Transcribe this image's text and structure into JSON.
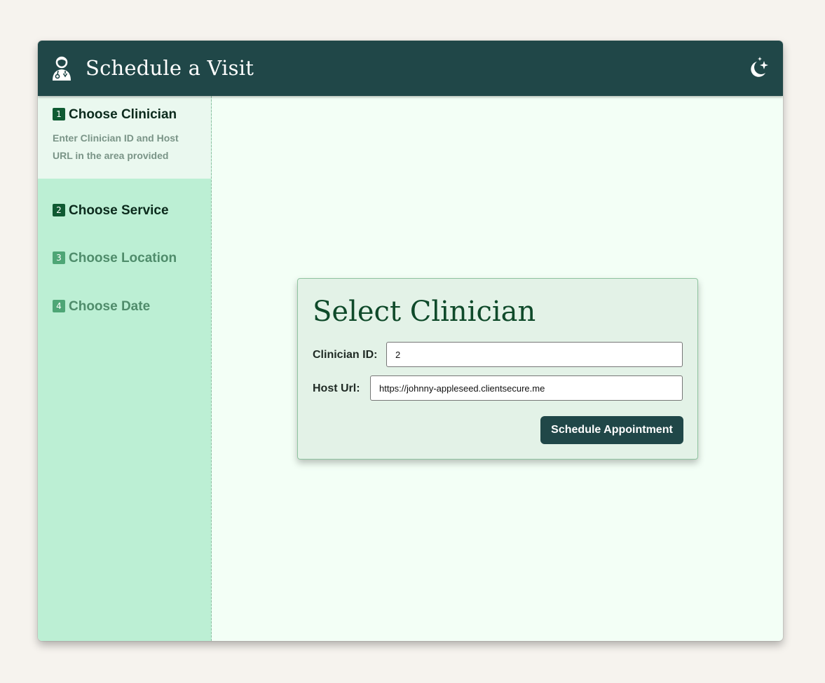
{
  "header": {
    "title": "Schedule a Visit",
    "logo_icon": "clinician-icon",
    "theme_toggle_icon": "moon-stars-icon"
  },
  "sidebar": {
    "steps": [
      {
        "number": "1",
        "label": "Choose Clinician",
        "description": "Enter Clinician ID and Host URL in the area provided",
        "state": "active"
      },
      {
        "number": "2",
        "label": "Choose Service",
        "state": "upcoming"
      },
      {
        "number": "3",
        "label": "Choose Location",
        "state": "disabled"
      },
      {
        "number": "4",
        "label": "Choose Date",
        "state": "disabled"
      }
    ]
  },
  "card": {
    "title": "Select Clinician",
    "clinician_id_label": "Clinician ID:",
    "clinician_id_value": "2",
    "host_url_label": "Host Url:",
    "host_url_value": "https://johnny-appleseed.clientsecure.me",
    "submit_label": "Schedule Appointment"
  },
  "colors": {
    "page_background": "#f6f3ee",
    "header": "#204748",
    "sidebar": "#bcefd4",
    "active_step": "#eaf8ef",
    "content": "#f3fff6",
    "card": "#e3f2e7",
    "accent": "#0f4a2a"
  }
}
